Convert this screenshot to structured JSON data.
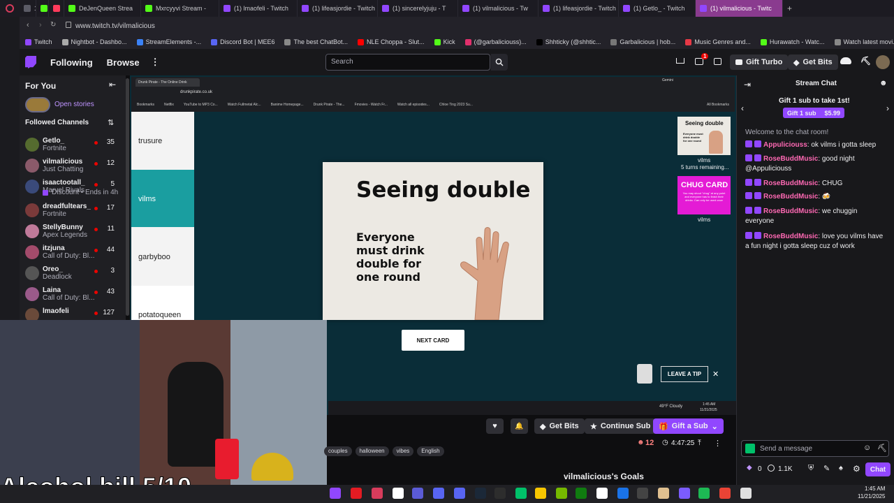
{
  "tabs": [
    {
      "label": "12",
      "color": "#5b5b66"
    },
    {
      "label": "",
      "color": "#53fc18"
    },
    {
      "label": "",
      "color": "#ff3b5c"
    },
    {
      "label": "DeJenQueen Strea",
      "color": "#53fc18"
    },
    {
      "label": "Mxrcyyvi Stream -",
      "color": "#53fc18"
    },
    {
      "label": "(1) lmaofeli - Twitch",
      "color": "#9147ff"
    },
    {
      "label": "(1) lifeasjordie - Twitch",
      "color": "#9147ff"
    },
    {
      "label": "(1) sincerelyjuju - T",
      "color": "#9147ff"
    },
    {
      "label": "(1) vilmalicious - Tw",
      "color": "#9147ff"
    },
    {
      "label": "(1) lifeasjordie - Twitch",
      "color": "#9147ff"
    },
    {
      "label": "(1) Getlo_ - Twitch",
      "color": "#9147ff"
    },
    {
      "label": "(1) vilmalicious - Twitc",
      "color": "#9147ff"
    }
  ],
  "url": "www.twitch.tv/vilmalicious",
  "bookmarks": [
    {
      "label": "Twitch",
      "color": "#9147ff"
    },
    {
      "label": "Nightbot - Dashbo...",
      "color": "#aaaaaa"
    },
    {
      "label": "StreamElements -...",
      "color": "#3b82f6"
    },
    {
      "label": "Discord Bot | MEE6",
      "color": "#5865f2"
    },
    {
      "label": "The best ChatBot...",
      "color": "#888888"
    },
    {
      "label": "NLE Choppa - Slut...",
      "color": "#ff0000"
    },
    {
      "label": "Kick",
      "color": "#53fc18"
    },
    {
      "label": "(@garbaliciouss)...",
      "color": "#e1306c"
    },
    {
      "label": "Shhticky (@shhtic...",
      "color": "#000000"
    },
    {
      "label": "Garbalicious | hob...",
      "color": "#777777"
    },
    {
      "label": "Music Genres and...",
      "color": "#e63946"
    },
    {
      "label": "Hurawatch - Watc...",
      "color": "#53fc18"
    },
    {
      "label": "Watch latest movi...",
      "color": "#888888"
    }
  ],
  "nav": {
    "following": "Following",
    "browse": "Browse",
    "search_placeholder": "Search",
    "notif_count": "1",
    "gift_turbo": "Gift Turbo",
    "get_bits": "Get Bits"
  },
  "sidebar": {
    "for_you": "For You",
    "open_stories": "Open stories",
    "followed_channels": "Followed Channels",
    "channels": [
      {
        "name": "Getlo_",
        "game": "Fortnite",
        "viewers": "35",
        "color": "#556b2f"
      },
      {
        "name": "vilmalicious",
        "game": "Just Chatting",
        "viewers": "12",
        "color": "#8b5a6a"
      },
      {
        "name": "isaactootall_",
        "game": "Marvel Rivals",
        "viewers": "5",
        "color": "#3a4a7a"
      },
      {
        "name": "",
        "game": "Discount • Ends in 4h",
        "viewers": "",
        "color": ""
      },
      {
        "name": "dreadfultears_",
        "game": "Fortnite",
        "viewers": "17",
        "color": "#7a3a3a"
      },
      {
        "name": "StellyBunny",
        "game": "Apex Legends",
        "viewers": "11",
        "color": "#c07a9a"
      },
      {
        "name": "itzjuna",
        "game": "Call of Duty: Bl...",
        "viewers": "44",
        "color": "#a34b6b"
      },
      {
        "name": "Oreo_",
        "game": "Deadlock",
        "viewers": "3",
        "color": "#555555"
      },
      {
        "name": "Laina",
        "game": "Call of Duty: Bl...",
        "viewers": "43",
        "color": "#9a5a8a"
      },
      {
        "name": "lmaofeli",
        "game": "",
        "viewers": "127",
        "color": "#6a4a3a"
      }
    ]
  },
  "inner_browser": {
    "tab": "Drunk Pirate - The Online Drink",
    "tab2": "Gemini",
    "url": "drunkpirate.co.uk",
    "bookmarks": [
      "Bookmarks",
      "Netflix",
      "YouTube to MP3 Co...",
      "Watch Fullmetal Alc...",
      "Banime Homepage...",
      "Drunk Pirate - The...",
      "Fmovies - Watch Fr...",
      "Watch all episodes...",
      "Chloe Ting 2023 Su..."
    ],
    "all_bookmarks": "All Bookmarks"
  },
  "game": {
    "players": [
      "trusure",
      "vilms",
      "garbyboo",
      "potatoqueen"
    ],
    "active_player": "vilms",
    "card_title": "Seeing double",
    "card_body": "Everyone must drink double for one round",
    "next_card": "NEXT CARD",
    "mini_card_title": "Seeing double",
    "mini_card_body": "Everyone must drink double for one round",
    "mini_player": "vilms",
    "turns_remaining": "5 turns remaining...",
    "chug_title": "CHUG CARD",
    "chug_body": "You may shout \"chug\" at any point and everyone has to finish their drinks. Can only be used once",
    "chug_player": "vilms",
    "leave_tip": "LEAVE A TIP",
    "weather": "49°F Cloudy",
    "time": "1:45 AM",
    "date": "11/21/2025"
  },
  "overlay_text": "Alcohol bill 5/10",
  "stream_info": {
    "get_bits": "Get Bits",
    "continue_sub": "Continue Sub",
    "gift_sub": "Gift a Sub",
    "viewers": "12",
    "uptime": "4:47:25",
    "tags": [
      "couples",
      "halloween",
      "vibes",
      "English"
    ],
    "goals": "vilmalicious's Goals"
  },
  "chat": {
    "title": "Stream Chat",
    "gift_prompt": "Gift 1 sub to take 1st!",
    "gift_btn": "Gift 1 sub",
    "gift_price": "$5.99",
    "welcome": "Welcome to the chat room!",
    "messages": [
      {
        "user": "Appuliciouss",
        "text": "ok vilms i gotta sleep",
        "color": "#ff69b4"
      },
      {
        "user": "RoseBuddMusic",
        "text": "good night @Appuliciouss",
        "color": "#ff69b4"
      },
      {
        "user": "RoseBuddMusic",
        "text": "CHUG",
        "color": "#ff69b4"
      },
      {
        "user": "RoseBuddMusic",
        "text": "🍻",
        "color": "#ff69b4"
      },
      {
        "user": "RoseBuddMusic",
        "text": "we chuggin everyone",
        "color": "#ff69b4"
      },
      {
        "user": "RoseBuddMusic",
        "text": "love you vilms have a fun night i gotta sleep cuz of work",
        "color": "#ff69b4"
      }
    ],
    "input_placeholder": "Send a message",
    "bits": "0",
    "points": "1.1K",
    "chat_btn": "Chat"
  },
  "win_clock": {
    "time": "1:45 AM",
    "date": "11/21/2025"
  }
}
